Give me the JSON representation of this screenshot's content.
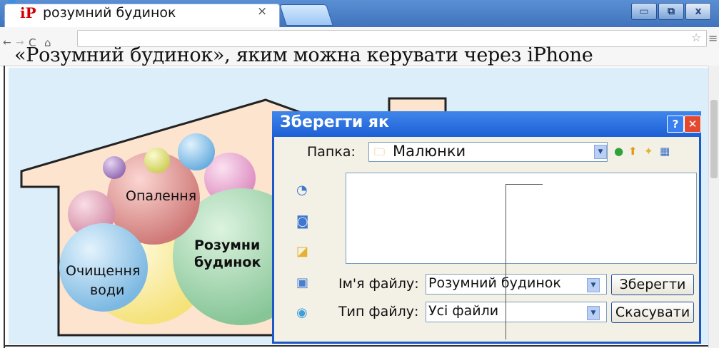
{
  "browser": {
    "tab": {
      "logo": "iP",
      "title": "розумний будинок",
      "close": "×"
    },
    "window_buttons": {
      "minimize": "▭",
      "maximize": "⧉",
      "close": "x"
    },
    "nav": {
      "back": "←",
      "forward": "→",
      "reload": "C",
      "home": "⌂"
    },
    "address_value": "",
    "star_icon": "☆",
    "menu_icon": "≡"
  },
  "page": {
    "heading": "«Розумний будинок», яким можна керувати через iPhone",
    "illustration": {
      "labels": {
        "heating": "Опалення",
        "smart_home_line1": "Розумни",
        "smart_home_line2": "будинок",
        "water_line1": "Очищення",
        "water_line2": "води"
      },
      "colors": {
        "house_fill": "#fde4cf",
        "background": "#dbeef9",
        "bubble_heating": "#e8a09c",
        "bubble_smart": "#a8d8b0",
        "bubble_water": "#a9d4ef",
        "bubble_yellow": "#fdf3a8",
        "bubble_pink": "#f0b0d8",
        "bubble_purple": "#b28ec9"
      }
    }
  },
  "dialog": {
    "title": "Зберегти як",
    "help_button": "?",
    "close_button": "✕",
    "folder_label": "Папка:",
    "folder_value": "Малюнки",
    "folder_icon": "folder-icon",
    "toolbar_icons": [
      "back-icon",
      "up-folder-icon",
      "new-folder-icon",
      "view-menu-icon"
    ],
    "places_icons": [
      "recent-icon",
      "desktop-icon",
      "documents-icon",
      "computer-icon",
      "network-icon"
    ],
    "filename_label": "Ім'я файлу:",
    "filename_value": "Розумний будинок",
    "filetype_label": "Тип файлу:",
    "filetype_value": "Усі файли",
    "save_button": "Зберегти",
    "cancel_button": "Скасувати"
  }
}
